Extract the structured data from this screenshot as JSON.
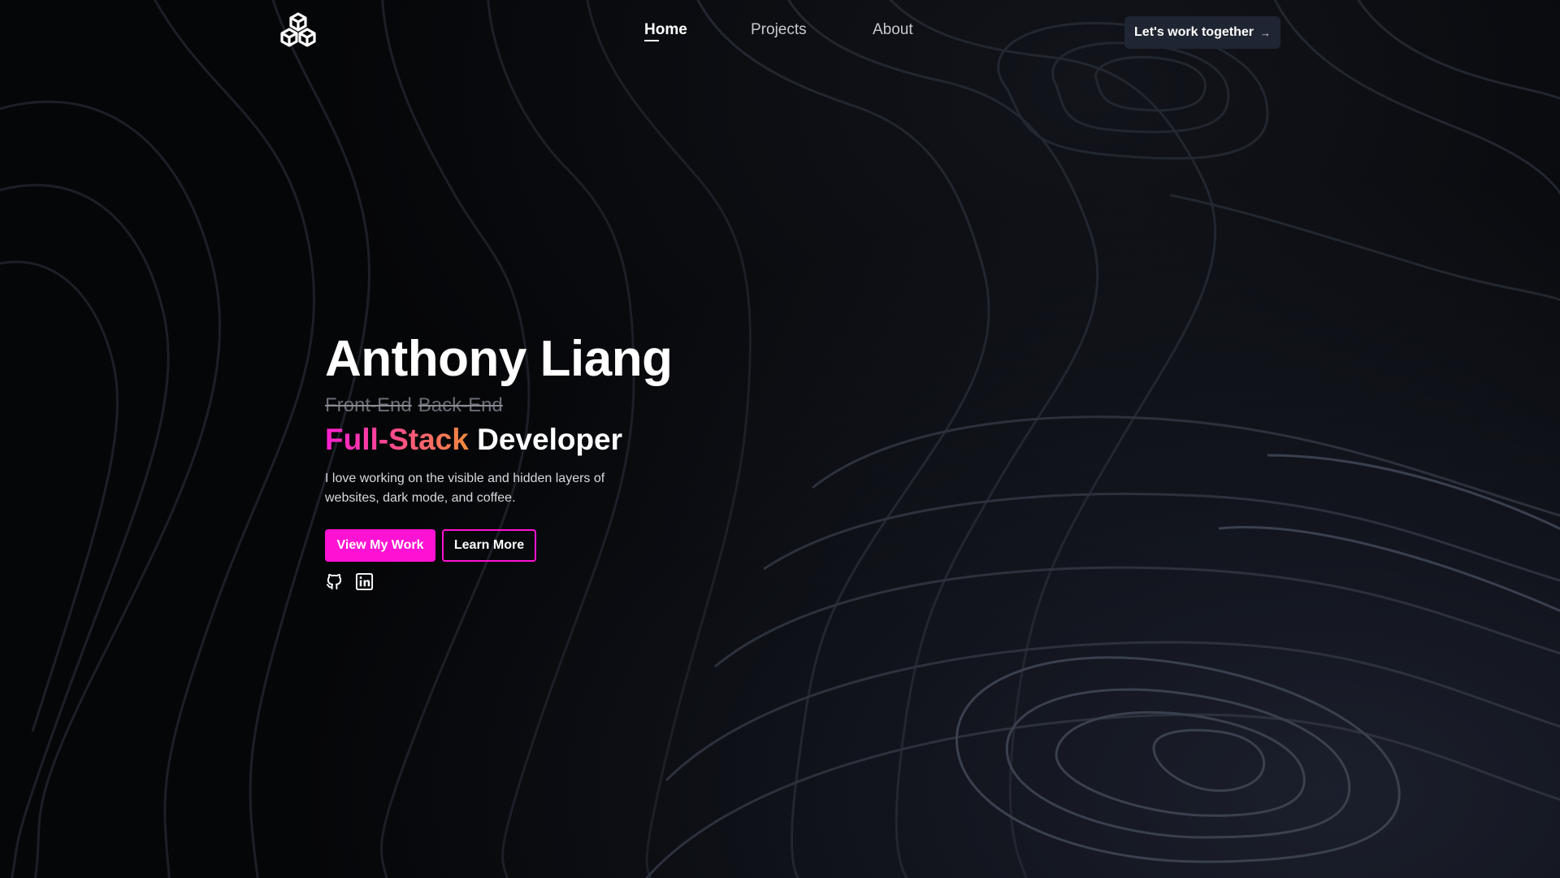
{
  "nav": {
    "logo_name": "cubes-logo",
    "items": [
      {
        "label": "Home",
        "active": true
      },
      {
        "label": "Projects",
        "active": false
      },
      {
        "label": "About",
        "active": false
      }
    ],
    "cta_label": "Let's work together",
    "cta_arrow": "→"
  },
  "hero": {
    "name": "Anthony Liang",
    "struck_roles": [
      "Front-End",
      "Back-End"
    ],
    "role_highlight": "Full-Stack",
    "role_rest": "Developer",
    "description": "I love working on the visible and hidden layers of websites, dark mode, and coffee.",
    "primary_button": "View My Work",
    "secondary_button": "Learn More",
    "socials": [
      "github-icon",
      "linkedin-icon"
    ]
  },
  "colors": {
    "accent": "#ff12d4",
    "gradient_start": "#ff1fd1",
    "gradient_end": "#f08a3c",
    "background": "#050608",
    "cta_background": "#1f2532"
  }
}
